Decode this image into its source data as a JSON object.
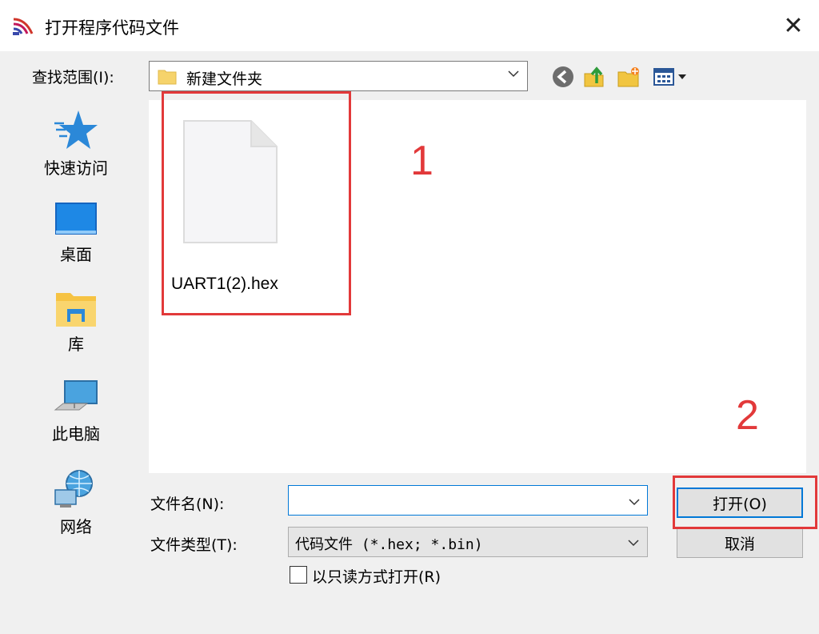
{
  "window": {
    "title": "打开程序代码文件"
  },
  "lookin": {
    "label": "查找范围(I):",
    "value": "新建文件夹"
  },
  "places": [
    {
      "label": "快速访问",
      "icon": "star-icon"
    },
    {
      "label": "桌面",
      "icon": "desktop-icon"
    },
    {
      "label": "库",
      "icon": "library-icon"
    },
    {
      "label": "此电脑",
      "icon": "computer-icon"
    },
    {
      "label": "网络",
      "icon": "network-icon"
    }
  ],
  "files": [
    {
      "name": "UART1(2).hex",
      "icon": "document-icon"
    }
  ],
  "annotations": {
    "step1": "1",
    "step2": "2",
    "color": "#e2393a"
  },
  "filename": {
    "label": "文件名(N):",
    "value": ""
  },
  "filetype": {
    "label": "文件类型(T):",
    "value": "代码文件 (*.hex; *.bin)"
  },
  "readonly": {
    "label": "以只读方式打开(R)",
    "checked": false
  },
  "buttons": {
    "open": "打开(O)",
    "cancel": "取消"
  }
}
